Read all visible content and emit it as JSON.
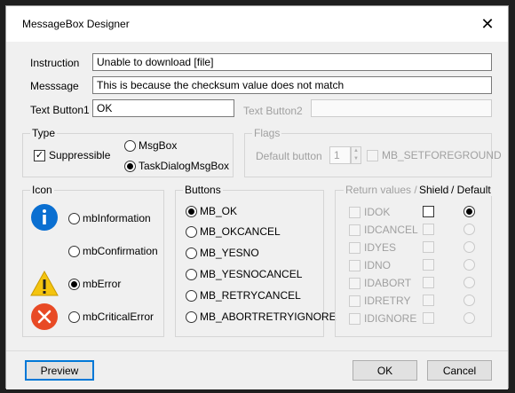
{
  "window": {
    "title": "MessageBox Designer",
    "close_glyph": "✕"
  },
  "fields": {
    "instruction_label": "Instruction",
    "instruction_value": "Unable to download [file]",
    "message_label": "Messsage",
    "message_value": "This is because the checksum value does not match",
    "button1_label": "Text Button1",
    "button1_value": "OK",
    "button2_label": "Text Button2",
    "button2_value": ""
  },
  "type_group": {
    "title": "Type",
    "suppressible_label": "Suppressible",
    "suppressible_checked": true,
    "msgbox_label": "MsgBox",
    "taskdialog_label": "TaskDialogMsgBox",
    "selected": "TaskDialogMsgBox"
  },
  "flags_group": {
    "title": "Flags",
    "default_button_label": "Default button",
    "default_button_value": "1",
    "setforeground_label": "MB_SETFOREGROUND"
  },
  "icon_group": {
    "title": "Icon",
    "options": [
      {
        "label": "mbInformation",
        "icon": "information-icon",
        "selected": false
      },
      {
        "label": "mbConfirmation",
        "icon": "",
        "selected": false
      },
      {
        "label": "mbError",
        "icon": "warning-icon",
        "selected": true
      },
      {
        "label": "mbCriticalError",
        "icon": "critical-error-icon",
        "selected": false
      }
    ]
  },
  "buttons_group": {
    "title": "Buttons",
    "options": [
      {
        "label": "MB_OK",
        "selected": true
      },
      {
        "label": "MB_OKCANCEL",
        "selected": false
      },
      {
        "label": "MB_YESNO",
        "selected": false
      },
      {
        "label": "MB_YESNOCANCEL",
        "selected": false
      },
      {
        "label": "MB_RETRYCANCEL",
        "selected": false
      },
      {
        "label": "MB_ABORTRETRYIGNORE",
        "selected": false
      }
    ]
  },
  "return_group": {
    "title": "Return values /",
    "shield_header": "Shield",
    "default_header": "/ Default",
    "rows": [
      {
        "label": "IDOK",
        "shield_enabled": true,
        "default_selected": true
      },
      {
        "label": "IDCANCEL",
        "shield_enabled": false,
        "default_selected": false
      },
      {
        "label": "IDYES",
        "shield_enabled": false,
        "default_selected": false
      },
      {
        "label": "IDNO",
        "shield_enabled": false,
        "default_selected": false
      },
      {
        "label": "IDABORT",
        "shield_enabled": false,
        "default_selected": false
      },
      {
        "label": "IDRETRY",
        "shield_enabled": false,
        "default_selected": false
      },
      {
        "label": "IDIGNORE",
        "shield_enabled": false,
        "default_selected": false
      }
    ]
  },
  "footer": {
    "preview_label": "Preview",
    "ok_label": "OK",
    "cancel_label": "Cancel"
  },
  "colors": {
    "accent": "#0078d7",
    "info": "#0a6fd1",
    "warning": "#f4c40f",
    "error": "#e84a25"
  }
}
